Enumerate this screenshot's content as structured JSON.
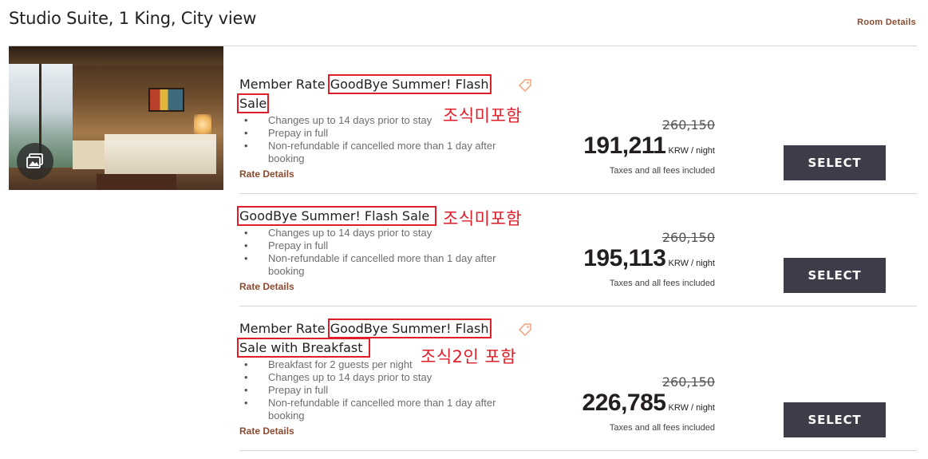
{
  "room": {
    "title": "Studio Suite, 1 King, City view",
    "details_link": "Room Details"
  },
  "rates": [
    {
      "prefix": "Member Rate",
      "name_line1": "GoodBye Summer! Flash",
      "name_line2": "Sale",
      "annotation": "조식미포함",
      "has_tag_icon": true,
      "bullets": [
        "Changes up to 14 days prior to stay",
        "Prepay in full",
        "Non-refundable if cancelled more than 1 day after",
        "booking"
      ],
      "details_link": "Rate Details",
      "old_price": "260,150",
      "price": "191,211",
      "unit": "KRW / night",
      "taxes": "Taxes and all fees included",
      "button": "SELECT"
    },
    {
      "prefix": "",
      "name_line1": "GoodBye Summer! Flash Sale",
      "name_line2": "",
      "annotation": "조식미포함",
      "has_tag_icon": false,
      "bullets": [
        "Changes up to 14 days prior to stay",
        "Prepay in full",
        "Non-refundable if cancelled more than 1 day after",
        "booking"
      ],
      "details_link": "Rate Details",
      "old_price": "260,150",
      "price": "195,113",
      "unit": "KRW / night",
      "taxes": "Taxes and all fees included",
      "button": "SELECT"
    },
    {
      "prefix": "Member Rate",
      "name_line1": "GoodBye Summer! Flash",
      "name_line2": "Sale with Breakfast",
      "annotation": "조식2인 포함",
      "has_tag_icon": true,
      "bullets": [
        "Breakfast for 2 guests per night",
        "Changes up to 14 days prior to stay",
        "Prepay in full",
        "Non-refundable if cancelled more than 1 day after",
        "booking"
      ],
      "details_link": "Rate Details",
      "old_price": "260,150",
      "price": "226,785",
      "unit": "KRW / night",
      "taxes": "Taxes and all fees included",
      "button": "SELECT"
    }
  ],
  "colors": {
    "annotation_red": "#e01e2a",
    "link_brown": "#8c4a2f",
    "button_bg": "#3f3c4a",
    "tag_icon": "#f0a07a"
  },
  "icons": {
    "gallery": "image-gallery-icon",
    "tag": "price-tag-icon"
  }
}
